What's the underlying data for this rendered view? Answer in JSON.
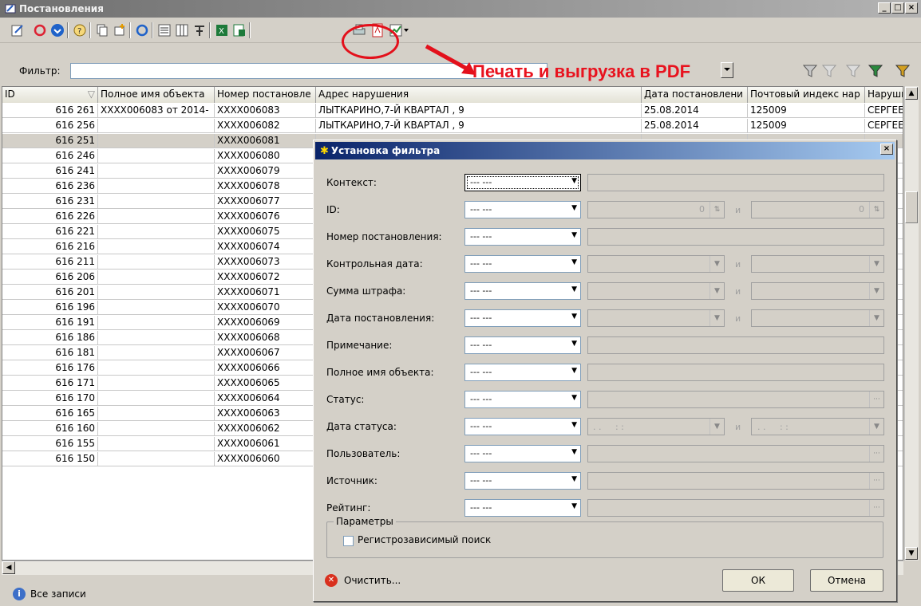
{
  "window": {
    "title": "Постановления"
  },
  "filter": {
    "label": "Фильтр:",
    "value": ""
  },
  "annotation": {
    "text": "Печать и выгрузка в PDF"
  },
  "toolbar": {
    "icons": [
      "edit-icon",
      "refresh-icon",
      "down-arrow-icon",
      "question-icon",
      "copy-icon",
      "add-icon",
      "sync-icon",
      "list-icon",
      "columns-icon",
      "fit-icon",
      "excel-icon",
      "export-icon",
      "print-icon",
      "pdf-icon",
      "chart-icon"
    ]
  },
  "grid": {
    "headers": [
      "ID",
      "Полное имя объекта",
      "Номер постановле",
      "Адрес нарушения",
      "Дата постановлени",
      "Почтовый индекс нар",
      "Наруши"
    ],
    "rows": [
      {
        "id": "616 261",
        "name": "XXXX006083 от 2014-",
        "num": "XXXX006083",
        "addr": "ЛЫТКАРИНО,7-Й КВАРТАЛ , 9",
        "date": "25.08.2014",
        "zip": "125009",
        "who": "СЕРГЕЕ"
      },
      {
        "id": "616 256",
        "name": "",
        "num": "XXXX006082",
        "addr": "ЛЫТКАРИНО,7-Й КВАРТАЛ , 9",
        "date": "25.08.2014",
        "zip": "125009",
        "who": "СЕРГЕЕ"
      },
      {
        "id": "616 251",
        "name": "",
        "num": "XXXX006081",
        "addr": "",
        "date": "",
        "zip": "",
        "who": ""
      },
      {
        "id": "616 246",
        "name": "",
        "num": "XXXX006080",
        "addr": "",
        "date": "",
        "zip": "",
        "who": ""
      },
      {
        "id": "616 241",
        "name": "",
        "num": "XXXX006079",
        "addr": "",
        "date": "",
        "zip": "",
        "who": ""
      },
      {
        "id": "616 236",
        "name": "",
        "num": "XXXX006078",
        "addr": "",
        "date": "",
        "zip": "",
        "who": ""
      },
      {
        "id": "616 231",
        "name": "",
        "num": "XXXX006077",
        "addr": "",
        "date": "",
        "zip": "",
        "who": ""
      },
      {
        "id": "616 226",
        "name": "",
        "num": "XXXX006076",
        "addr": "",
        "date": "",
        "zip": "",
        "who": ""
      },
      {
        "id": "616 221",
        "name": "",
        "num": "XXXX006075",
        "addr": "",
        "date": "",
        "zip": "",
        "who": ""
      },
      {
        "id": "616 216",
        "name": "",
        "num": "XXXX006074",
        "addr": "",
        "date": "",
        "zip": "",
        "who": ""
      },
      {
        "id": "616 211",
        "name": "",
        "num": "XXXX006073",
        "addr": "",
        "date": "",
        "zip": "",
        "who": ""
      },
      {
        "id": "616 206",
        "name": "",
        "num": "XXXX006072",
        "addr": "",
        "date": "",
        "zip": "",
        "who": ""
      },
      {
        "id": "616 201",
        "name": "",
        "num": "XXXX006071",
        "addr": "",
        "date": "",
        "zip": "",
        "who": ""
      },
      {
        "id": "616 196",
        "name": "",
        "num": "XXXX006070",
        "addr": "",
        "date": "",
        "zip": "",
        "who": ""
      },
      {
        "id": "616 191",
        "name": "",
        "num": "XXXX006069",
        "addr": "",
        "date": "",
        "zip": "",
        "who": ""
      },
      {
        "id": "616 186",
        "name": "",
        "num": "XXXX006068",
        "addr": "",
        "date": "",
        "zip": "",
        "who": ""
      },
      {
        "id": "616 181",
        "name": "",
        "num": "XXXX006067",
        "addr": "",
        "date": "",
        "zip": "",
        "who": ""
      },
      {
        "id": "616 176",
        "name": "",
        "num": "XXXX006066",
        "addr": "",
        "date": "",
        "zip": "",
        "who": ""
      },
      {
        "id": "616 171",
        "name": "",
        "num": "XXXX006065",
        "addr": "",
        "date": "",
        "zip": "",
        "who": ""
      },
      {
        "id": "616 170",
        "name": "",
        "num": "XXXX006064",
        "addr": "",
        "date": "",
        "zip": "",
        "who": ""
      },
      {
        "id": "616 165",
        "name": "",
        "num": "XXXX006063",
        "addr": "",
        "date": "",
        "zip": "",
        "who": ""
      },
      {
        "id": "616 160",
        "name": "",
        "num": "XXXX006062",
        "addr": "",
        "date": "",
        "zip": "",
        "who": ""
      },
      {
        "id": "616 155",
        "name": "",
        "num": "XXXX006061",
        "addr": "",
        "date": "",
        "zip": "",
        "who": ""
      },
      {
        "id": "616 150",
        "name": "",
        "num": "XXXX006060",
        "addr": "",
        "date": "",
        "zip": "",
        "who": ""
      }
    ],
    "selected_index": 2
  },
  "status": {
    "text": "Все записи"
  },
  "dialog": {
    "title": "Установка фильтра",
    "fields": [
      {
        "label": "Контекст:",
        "op": "--- ---",
        "kind": "text"
      },
      {
        "label": "ID:",
        "op": "--- ---",
        "kind": "spin",
        "v1": "0",
        "v2": "0"
      },
      {
        "label": "Номер постановления:",
        "op": "--- ---",
        "kind": "text"
      },
      {
        "label": "Контрольная дата:",
        "op": "--- ---",
        "kind": "range"
      },
      {
        "label": "Сумма штрафа:",
        "op": "--- ---",
        "kind": "range"
      },
      {
        "label": "Дата постановления:",
        "op": "--- ---",
        "kind": "range"
      },
      {
        "label": "Примечание:",
        "op": "--- ---",
        "kind": "text"
      },
      {
        "label": "Полное имя объекта:",
        "op": "--- ---",
        "kind": "text"
      },
      {
        "label": "Статус:",
        "op": "--- ---",
        "kind": "ellipsis"
      },
      {
        "label": "Дата статуса:",
        "op": "--- ---",
        "kind": "datetime",
        "mask": ". .     : :"
      },
      {
        "label": "Пользователь:",
        "op": "--- ---",
        "kind": "ellipsis"
      },
      {
        "label": "Источник:",
        "op": "--- ---",
        "kind": "ellipsis"
      },
      {
        "label": "Рейтинг:",
        "op": "--- ---",
        "kind": "ellipsis"
      }
    ],
    "and_label": "и",
    "params_label": "Параметры",
    "case_sensitive_label": "Регистрозависимый поиск",
    "case_sensitive_checked": false,
    "clear_label": "Очистить...",
    "ok_label": "ОК",
    "cancel_label": "Отмена"
  },
  "colors": {
    "annotation": "#e8121e",
    "dialog_title": "#0a246a"
  }
}
